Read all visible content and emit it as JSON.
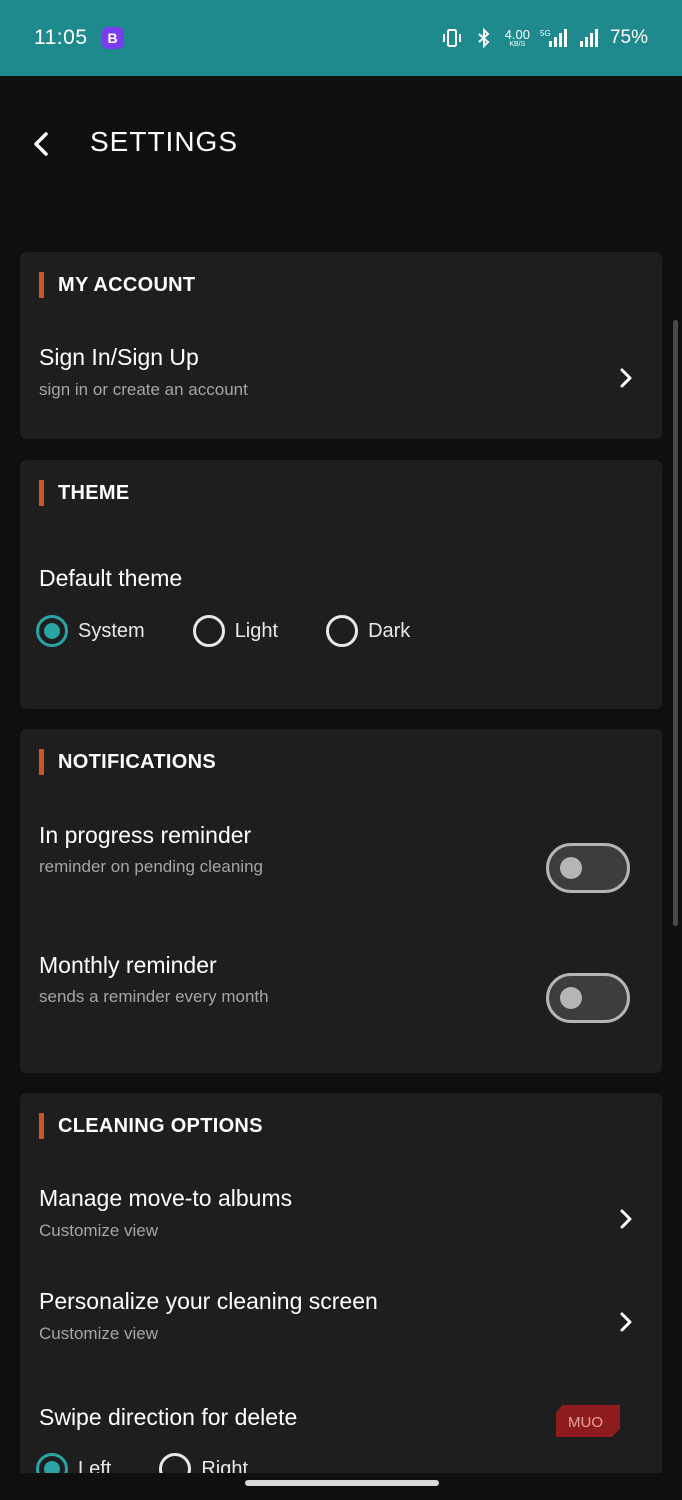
{
  "status_bar": {
    "time": "11:05",
    "app_badge": "B",
    "speed_value": "4.00",
    "speed_unit": "KB/S",
    "network": "5G",
    "battery": "75%"
  },
  "header": {
    "title": "SETTINGS"
  },
  "sections": {
    "account": {
      "heading": "MY ACCOUNT",
      "item": {
        "title": "Sign In/Sign Up",
        "subtitle": "sign in or create an account"
      }
    },
    "theme": {
      "heading": "THEME",
      "label": "Default theme",
      "options": [
        "System",
        "Light",
        "Dark"
      ],
      "selected": "System"
    },
    "notifications": {
      "heading": "NOTIFICATIONS",
      "items": [
        {
          "title": "In progress reminder",
          "subtitle": "reminder on pending cleaning",
          "enabled": false
        },
        {
          "title": "Monthly reminder",
          "subtitle": "sends a reminder every month",
          "enabled": false
        }
      ]
    },
    "cleaning": {
      "heading": "CLEANING OPTIONS",
      "items": [
        {
          "title": "Manage move-to albums",
          "subtitle": "Customize view"
        },
        {
          "title": "Personalize your cleaning screen",
          "subtitle": "Customize view"
        }
      ],
      "swipe": {
        "label": "Swipe direction for delete",
        "options": [
          "Left",
          "Right"
        ],
        "selected": "Left"
      }
    }
  },
  "watermark": "MUO",
  "colors": {
    "status_bar": "#1f8a8e",
    "accent": "#2aa3a3",
    "section_bar": "#c8562a",
    "card": "#1e1e1f",
    "background": "#0f0f0f"
  }
}
